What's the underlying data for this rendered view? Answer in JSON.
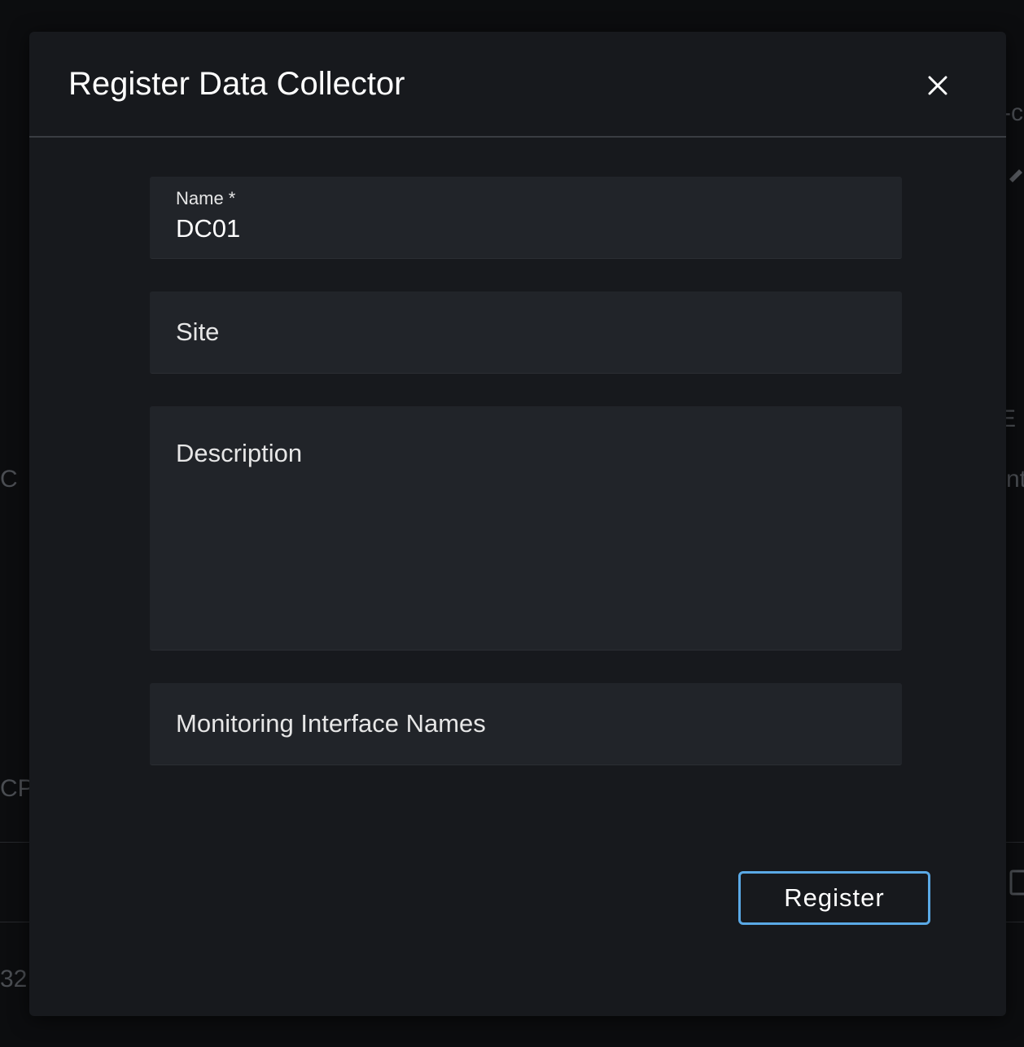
{
  "background": {
    "fragments": [
      "-c",
      "E",
      "C",
      "nt",
      "CPU",
      "32."
    ]
  },
  "dialog": {
    "title": "Register Data Collector",
    "close_icon": "close-icon",
    "fields": {
      "name": {
        "label": "Name *",
        "value": "DC01"
      },
      "site": {
        "placeholder": "Site",
        "value": ""
      },
      "description": {
        "placeholder": "Description",
        "value": ""
      },
      "monitoring_interfaces": {
        "placeholder": "Monitoring Interface Names",
        "value": ""
      }
    },
    "register_label": "Register"
  },
  "colors": {
    "modal_bg": "#17191d",
    "field_bg": "#212429",
    "accent": "#5aa9e6",
    "text": "#ffffff"
  }
}
